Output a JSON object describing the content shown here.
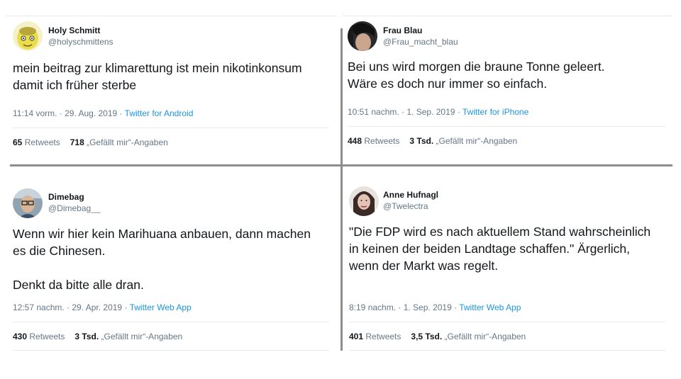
{
  "tweets": [
    {
      "name": "Holy Schmitt",
      "handle": "@holyschmittens",
      "text": "mein beitrag zur klimarettung ist mein nikotinkonsum\ndamit ich früher sterbe",
      "time": "11:14 vorm. · 29. Aug. 2019 · ",
      "source": "Twitter for Android",
      "retweets_count": "65",
      "retweets_label": " Retweets",
      "likes_count": "718",
      "likes_label": " „Gefällt mir“-Angaben",
      "avatar_icon": "yellow-cartoon-avatar-icon"
    },
    {
      "name": "Frau Blau",
      "handle": "@Frau_macht_blau",
      "text": "Bei uns wird morgen die braune Tonne geleert.\nWäre es doch nur immer so einfach.",
      "time": "10:51 nachm. · 1. Sep. 2019 · ",
      "source": "Twitter for iPhone",
      "retweets_count": "448",
      "retweets_label": " Retweets",
      "likes_count": "3 Tsd.",
      "likes_label": " „Gefällt mir“-Angaben",
      "avatar_icon": "dark-hair-avatar-icon"
    },
    {
      "name": "Dimebag",
      "handle": "@Dimebag__",
      "text": "Wenn wir hier kein Marihuana anbauen, dann machen\nes die Chinesen.\n\nDenkt da bitte alle dran.",
      "time": "12:57 nachm. · 29. Apr. 2019 · ",
      "source": "Twitter Web App",
      "retweets_count": "430",
      "retweets_label": " Retweets",
      "likes_count": "3 Tsd.",
      "likes_label": " „Gefällt mir“-Angaben",
      "avatar_icon": "glasses-man-avatar-icon"
    },
    {
      "name": "Anne Hufnagl",
      "handle": "@Twelectra",
      "text": "\"Die FDP wird es nach aktuellem Stand wahrscheinlich\nin keinen der beiden Landtage schaffen.\" Ärgerlich,\nwenn der Markt was regelt.",
      "time": "8:19 nachm. · 1. Sep. 2019 · ",
      "source": "Twitter Web App",
      "retweets_count": "401",
      "retweets_label": " Retweets",
      "likes_count": "3,5 Tsd.",
      "likes_label": " „Gefällt mir“-Angaben",
      "avatar_icon": "woman-portrait-avatar-icon"
    }
  ],
  "colors": {
    "link": "#1b95e0",
    "secondary_text": "#657786",
    "primary_text": "#14171a",
    "divider": "#8d8d8d",
    "hairline": "#e6ecf0"
  }
}
